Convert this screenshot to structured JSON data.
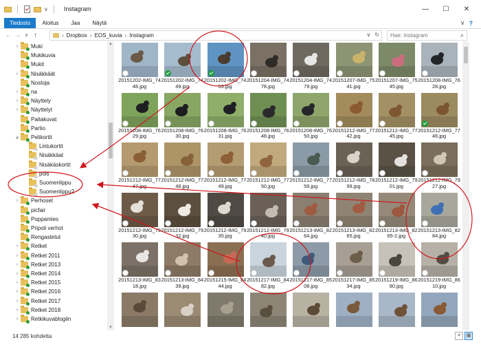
{
  "window": {
    "title": "Instagram",
    "quick_access_label": "∨",
    "buttons": {
      "minimize": "—",
      "maximize": "☐",
      "close": "✕"
    }
  },
  "ribbon": {
    "tabs": [
      "Tiedosto",
      "Aloitus",
      "Jaa",
      "Näytä"
    ],
    "expand_icon": "∨",
    "help_icon": "?"
  },
  "address": {
    "back": "←",
    "forward": "→",
    "recent": "∨",
    "up": "↑",
    "breadcrumbs": [
      "Dropbox",
      "EOS_kuvia",
      "Instagram"
    ],
    "separator": "›",
    "dropdown": "∨",
    "refresh": "↻",
    "search_placeholder": "Hae: Instagram",
    "search_icon": "⌕"
  },
  "nav_items": [
    {
      "label": "Muki",
      "expanded": false,
      "indent": 0,
      "badge": "green"
    },
    {
      "label": "Mukikuvia",
      "expanded": null,
      "indent": 0,
      "badge": "green"
    },
    {
      "label": "Mukit",
      "expanded": null,
      "indent": 0,
      "badge": "green"
    },
    {
      "label": "Nisäkkäät",
      "expanded": false,
      "indent": 0,
      "badge": "green"
    },
    {
      "label": "Nostoja",
      "expanded": null,
      "indent": 0,
      "badge": "green"
    },
    {
      "label": "na",
      "expanded": false,
      "indent": 0,
      "badge": "green"
    },
    {
      "label": "Näyttely",
      "expanded": false,
      "indent": 0,
      "badge": "green"
    },
    {
      "label": "Näyttelyt",
      "expanded": false,
      "indent": 0,
      "badge": "green"
    },
    {
      "label": "Paitakuvat",
      "expanded": null,
      "indent": 0,
      "badge": "green"
    },
    {
      "label": "Partio",
      "expanded": null,
      "indent": 0,
      "badge": "green"
    },
    {
      "label": "Pelikortit",
      "expanded": true,
      "indent": 0,
      "badge": "green"
    },
    {
      "label": "Lintukortit",
      "expanded": null,
      "indent": 1,
      "badge": "green"
    },
    {
      "label": "Nisäkkäat",
      "expanded": null,
      "indent": 1,
      "badge": "green"
    },
    {
      "label": "Nisäkäskortit",
      "expanded": null,
      "indent": 1,
      "badge": "green"
    },
    {
      "label": "pois",
      "expanded": null,
      "indent": 1,
      "badge": "green"
    },
    {
      "label": "Suomenlippu",
      "expanded": null,
      "indent": 1,
      "badge": "green"
    },
    {
      "label": "Suomenlippu2",
      "expanded": null,
      "indent": 1,
      "badge": "green"
    },
    {
      "label": "Perhoset",
      "expanded": false,
      "indent": 0,
      "badge": "green"
    },
    {
      "label": "picfair",
      "expanded": null,
      "indent": 0,
      "badge": "green"
    },
    {
      "label": "Poppamies",
      "expanded": null,
      "indent": 0,
      "badge": "green"
    },
    {
      "label": "Pripoli verhot",
      "expanded": null,
      "indent": 0,
      "badge": "green"
    },
    {
      "label": "Rengastetut",
      "expanded": null,
      "indent": 0,
      "badge": "green"
    },
    {
      "label": "Retket",
      "expanded": false,
      "indent": 0,
      "badge": "green"
    },
    {
      "label": "Retket 2011",
      "expanded": false,
      "indent": 0,
      "badge": "green"
    },
    {
      "label": "Retket 2013",
      "expanded": false,
      "indent": 0,
      "badge": "green"
    },
    {
      "label": "Retket 2014",
      "expanded": false,
      "indent": 0,
      "badge": "green"
    },
    {
      "label": "Retket 2015",
      "expanded": false,
      "indent": 0,
      "badge": "green"
    },
    {
      "label": "Retket 2016",
      "expanded": false,
      "indent": 0,
      "badge": "green"
    },
    {
      "label": "Retket 2017",
      "expanded": false,
      "indent": 0,
      "badge": "green"
    },
    {
      "label": "Retket 2018",
      "expanded": false,
      "indent": 0,
      "badge": "green"
    },
    {
      "label": "Retkikuvablogiin",
      "expanded": false,
      "indent": 0,
      "badge": "green"
    }
  ],
  "files": [
    {
      "name": "20151202-IMG_7448.jpg",
      "line1": "20151202-IMG_74",
      "line2": "48.jpg",
      "status": "cloud",
      "bg": "#9fb6c9",
      "fg": "#6b5a45"
    },
    {
      "name": "20151202-IMG_7449.jpg",
      "line1": "20151202-IMG_74",
      "line2": "49.jpg",
      "status": "ok",
      "bg": "#a5bccf",
      "fg": "#5e4e3c"
    },
    {
      "name": "20151202-IMG_7453.jpg",
      "line1": "20151202-IMG_74",
      "line2": "53.jpg",
      "status": "ok",
      "bg": "#5f93c2",
      "fg": "#4a3c2e"
    },
    {
      "name": "20151204-IMG_7478.jpg",
      "line1": "20151204-IMG_74",
      "line2": "78.jpg",
      "status": "cloud",
      "bg": "#7a7064",
      "fg": "#2f2b27"
    },
    {
      "name": "20151204-IMG_7479.jpg",
      "line1": "20151204-IMG_74",
      "line2": "79.jpg",
      "status": "cloud",
      "bg": "#6f6a60",
      "fg": "#e6e6e6"
    },
    {
      "name": "20151207-IMG_7541.jpg",
      "line1": "20151207-IMG_75",
      "line2": "41.jpg",
      "status": "cloud",
      "bg": "#8d9474",
      "fg": "#c9b36a"
    },
    {
      "name": "20151207-IMG_7545.jpg",
      "line1": "20151207-IMG_75",
      "line2": "45.jpg",
      "status": "cloud",
      "bg": "#7d8a67",
      "fg": "#cc6d7f"
    },
    {
      "name": "20151208-IMG_7628.jpg",
      "line1": "20151208-IMG_76",
      "line2": "28.jpg",
      "status": "cloud",
      "bg": "#a9b3bb",
      "fg": "#222428"
    },
    {
      "name": "20151208-IMG_7629.jpg",
      "line1": "20151208-IMG_76",
      "line2": "29.jpg",
      "status": "cloud",
      "bg": "#7ea35a",
      "fg": "#1f1f22"
    },
    {
      "name": "20151208-IMG_7630.jpg",
      "line1": "20151208-IMG_76",
      "line2": "30.jpg",
      "status": "cloud",
      "bg": "#87a763",
      "fg": "#1d1d20"
    },
    {
      "name": "20151208-IMG_7631.jpg",
      "line1": "20151208-IMG_76",
      "line2": "31.jpg",
      "status": "cloud",
      "bg": "#8fae6a",
      "fg": "#202024"
    },
    {
      "name": "20151208-IMG_7648.jpg",
      "line1": "20151208-IMG_76",
      "line2": "48.jpg",
      "status": "cloud",
      "bg": "#6f8f52",
      "fg": "#2a2a2e"
    },
    {
      "name": "20151208-IMG_7650.jpg",
      "line1": "20151208-IMG_76",
      "line2": "50.jpg",
      "status": "cloud",
      "bg": "#8ea56b",
      "fg": "#26262a"
    },
    {
      "name": "20151212-IMG_7742.jpg",
      "line1": "20151212-IMG_77",
      "line2": "42.jpg",
      "status": "cloud",
      "bg": "#a28c5e",
      "fg": "#8a5a30"
    },
    {
      "name": "20151212-IMG_7745.jpg",
      "line1": "20151212-IMG_77",
      "line2": "45.jpg",
      "status": "cloud",
      "bg": "#a39165",
      "fg": "#7d5732"
    },
    {
      "name": "20151212-IMG_7746.jpg",
      "line1": "20151212-IMG_77",
      "line2": "46.jpg",
      "status": "ok",
      "bg": "#9c8b60",
      "fg": "#7a5530"
    },
    {
      "name": "20151212-IMG_7747.jpg",
      "line1": "20151212-IMG_77",
      "line2": "47.jpg",
      "status": "cloud",
      "bg": "#b59a70",
      "fg": "#8a5e36"
    },
    {
      "name": "20151212-IMG_7748.jpg",
      "line1": "20151212-IMG_77",
      "line2": "48.jpg",
      "status": "cloud",
      "bg": "#ae9568",
      "fg": "#87613a"
    },
    {
      "name": "20151212-IMG_7749.jpg",
      "line1": "20151212-IMG_77",
      "line2": "49.jpg",
      "status": "cloud",
      "bg": "#b49c72",
      "fg": "#8d6038"
    },
    {
      "name": "20151212-IMG_7750.jpg",
      "line1": "20151212-IMG_77",
      "line2": "50.jpg",
      "status": "cloud",
      "bg": "#c1a97d",
      "fg": "#90643c"
    },
    {
      "name": "20151212-IMG_7759.jpg",
      "line1": "20151212-IMG_77",
      "line2": "59.jpg",
      "status": "cloud",
      "bg": "#8a9aa6",
      "fg": "#4b5a50"
    },
    {
      "name": "20151212-IMG_7899.jpg",
      "line1": "20151212-IMG_78",
      "line2": "99.jpg",
      "status": "cloud",
      "bg": "#6b6256",
      "fg": "#d9d3c8"
    },
    {
      "name": "20151212-IMG_7901.jpg",
      "line1": "20151212-IMG_79",
      "line2": "01.jpg",
      "status": "cloud",
      "bg": "#5a5245",
      "fg": "#e4e2dc"
    },
    {
      "name": "20151212-IMG_7927.jpg",
      "line1": "20151212-IMG_79",
      "line2": "27.jpg",
      "status": "cloud",
      "bg": "#7b6e5a",
      "fg": "#cfc6b3"
    },
    {
      "name": "20151212-IMG_7930.jpg",
      "line1": "20151212-IMG_79",
      "line2": "30.jpg",
      "status": "cloud",
      "bg": "#6d5b48",
      "fg": "#e5e0d8"
    },
    {
      "name": "20151212-IMG_7932.jpg",
      "line1": "20151212-IMG_79",
      "line2": "32.jpg",
      "status": "cloud",
      "bg": "#5d4f3f",
      "fg": "#eeeae3"
    },
    {
      "name": "20151212-IMG_7935.jpg",
      "line1": "20151212-IMG_79",
      "line2": "35.jpg",
      "status": "cloud",
      "bg": "#4f4a44",
      "fg": "#dedad2"
    },
    {
      "name": "20151212-IMG_7940.jpg",
      "line1": "20151212-IMG_79",
      "line2": "40.jpg",
      "status": "cloud",
      "bg": "#6a6058",
      "fg": "#c3bcb2"
    },
    {
      "name": "20151213-IMG_8264.jpg",
      "line1": "20151213-IMG_82",
      "line2": "64.jpg",
      "status": "cloud",
      "bg": "#8a7f70",
      "fg": "#9f5a42"
    },
    {
      "name": "20151213-IMG_8265.jpg",
      "line1": "20151213-IMG_82",
      "line2": "65.jpg",
      "status": "cloud",
      "bg": "#8f8474",
      "fg": "#a35c44"
    },
    {
      "name": "20151213-IMG_8265-2.jpg",
      "line1": "20151213-IMG_82",
      "line2": "65-2.jpg",
      "status": "cloud",
      "bg": "#958a79",
      "fg": "#9c5841"
    },
    {
      "name": "20151213-IMG_8284.jpg",
      "line1": "20151213-IMG_82",
      "line2": "84.jpg",
      "status": "cloud",
      "bg": "#a7a79b",
      "fg": "#3f6fb5"
    },
    {
      "name": "20151213-IMG_8318.jpg",
      "line1": "20151213-IMG_83",
      "line2": "18.jpg",
      "status": "cloud",
      "bg": "#7c7166",
      "fg": "#e8e6e2"
    },
    {
      "name": "20151213-IMG_8439.jpg",
      "line1": "20151213-IMG_84",
      "line2": "39.jpg",
      "status": "cloud",
      "bg": "#8e7a66",
      "fg": "#d2c2ad"
    },
    {
      "name": "20151215-IMG_8444.jpg",
      "line1": "20151215-IMG_84",
      "line2": "44.jpg",
      "status": "cloud",
      "bg": "#8b6f52",
      "fg": "#c66a55"
    },
    {
      "name": "20151217-IMG_8482.jpg",
      "line1": "20151217-IMG_84",
      "line2": "82.jpg",
      "status": "cloud",
      "bg": "#c9d4dc",
      "fg": "#6b5a4b"
    },
    {
      "name": "20151217-IMG_8508.jpg",
      "line1": "20151217-IMG_85",
      "line2": "08.jpg",
      "status": "cloud",
      "bg": "#8d9aa8",
      "fg": "#3d5a7a"
    },
    {
      "name": "20151217-IMG_8534.jpg",
      "line1": "20151217-IMG_85",
      "line2": "34.jpg",
      "status": "cloud",
      "bg": "#a79f93",
      "fg": "#6d5d4b"
    },
    {
      "name": "20151219-IMG_8680.jpg",
      "line1": "20151219-IMG_86",
      "line2": "80.jpg",
      "status": "cloud",
      "bg": "#c7c2b9",
      "fg": "#4a4640"
    },
    {
      "name": "20151219-IMG_8610.jpg",
      "line1": "20151219-IMG_86",
      "line2": "10.jpg",
      "status": "cloud",
      "bg": "#b6b0a6",
      "fg": "#524c45"
    },
    {
      "name": "row6-1",
      "line1": "",
      "line2": "",
      "status": "none",
      "bg": "#8a7a66",
      "fg": "#5a4a38"
    },
    {
      "name": "row6-2",
      "line1": "",
      "line2": "",
      "status": "none",
      "bg": "#9b8b74",
      "fg": "#d8d0c4"
    },
    {
      "name": "row6-3",
      "line1": "",
      "line2": "",
      "status": "none",
      "bg": "#7f7a6c",
      "fg": "#a8a090"
    },
    {
      "name": "row6-4",
      "line1": "",
      "line2": "",
      "status": "none",
      "bg": "#8d8676",
      "fg": "#5a5040"
    },
    {
      "name": "row6-5",
      "line1": "",
      "line2": "",
      "status": "none",
      "bg": "#b8b2a3",
      "fg": "#5b4a36"
    },
    {
      "name": "row6-6",
      "line1": "",
      "line2": "",
      "status": "none",
      "bg": "#9fb0c4",
      "fg": "#7a5a3c"
    },
    {
      "name": "row6-7",
      "line1": "",
      "line2": "",
      "status": "none",
      "bg": "#a9b8c8",
      "fg": "#6e5236"
    },
    {
      "name": "row6-8",
      "line1": "",
      "line2": "",
      "status": "none",
      "bg": "#93a7bc",
      "fg": "#8a5a34"
    }
  ],
  "status": {
    "item_count": "14 285 kohdetta"
  },
  "annotation_color": "#d0161b",
  "colors": {
    "accent": "#1979ca",
    "folder": "#e8c15c",
    "synced": "#1e9c3c"
  }
}
